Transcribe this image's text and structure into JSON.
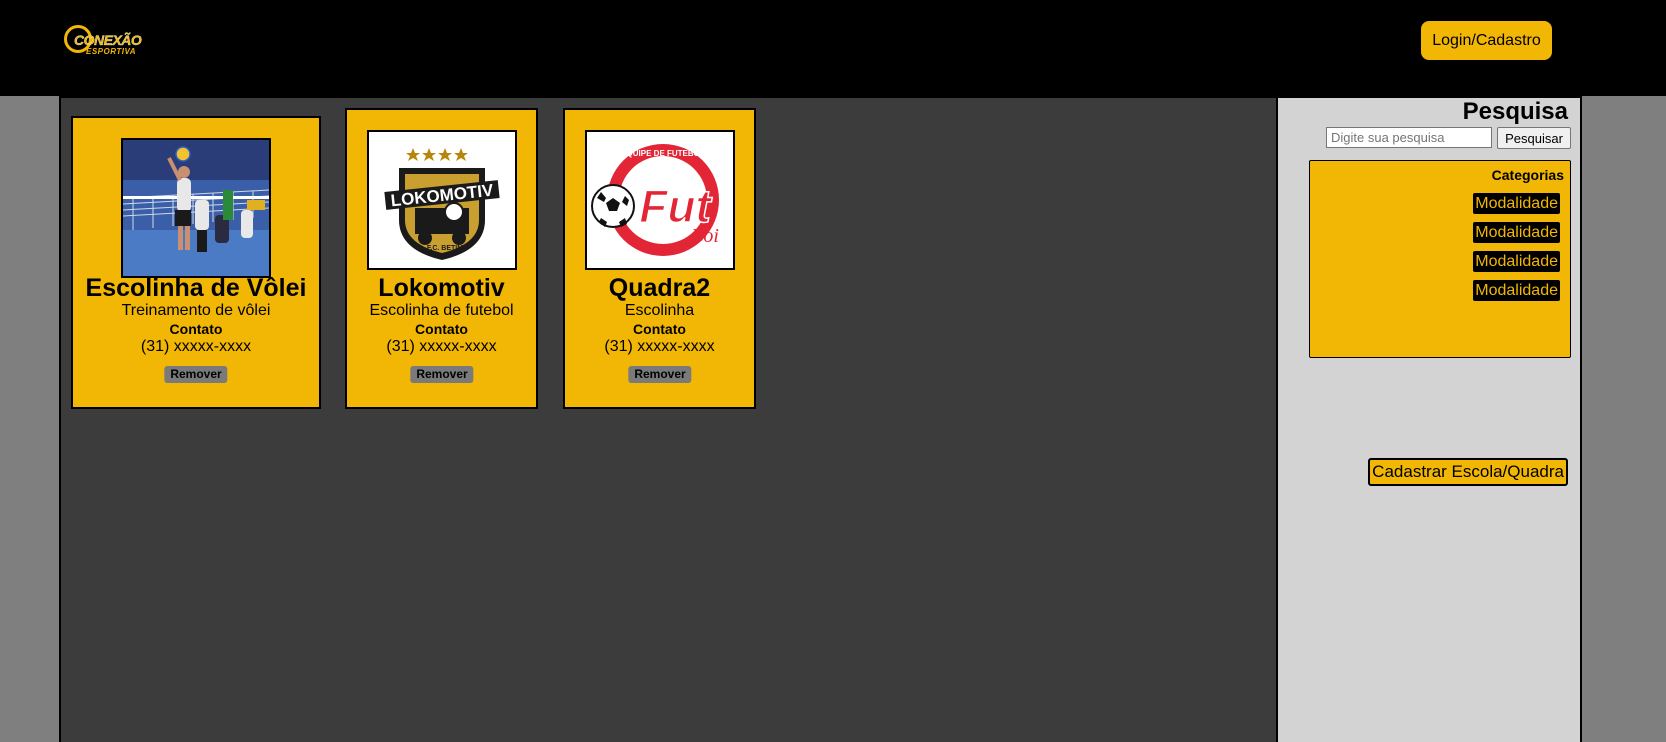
{
  "header": {
    "logo_line1": "CONEXÃO",
    "logo_line2": "ESPORTIVA",
    "login_label": "Login/Cadastro"
  },
  "cards": [
    {
      "title": "Escolinha de Vôlei",
      "description": "Treinamento de vôlei",
      "contact_label": "Contato",
      "phone": "(31) xxxxx-xxxx",
      "remove_label": "Remover"
    },
    {
      "title": "Lokomotiv",
      "description": "Escolinha de futebol",
      "contact_label": "Contato",
      "phone": "(31) xxxxx-xxxx",
      "remove_label": "Remover",
      "logo_text": "LOKOMOTIV",
      "logo_subtext": "F.C. BETIM"
    },
    {
      "title": "Quadra2",
      "description": "Escolinha",
      "contact_label": "Contato",
      "phone": "(31) xxxxx-xxxx",
      "remove_label": "Remover",
      "logo_text": "Fut",
      "logo_subtext": "Boi",
      "logo_ring_text": "EQUIPE DE FUTEBOL"
    }
  ],
  "sidebar": {
    "search_title": "Pesquisa",
    "search_placeholder": "Digite sua pesquisa",
    "search_button": "Pesquisar",
    "categories_title": "Categorias",
    "categories": [
      "Modalidade",
      "Modalidade",
      "Modalidade",
      "Modalidade"
    ],
    "register_label": "Cadastrar Escola/Quadra"
  },
  "colors": {
    "accent": "#f2b705",
    "header_bg": "#000000",
    "main_bg": "#3c3c3c",
    "sidebar_bg": "#d3d3d3"
  }
}
